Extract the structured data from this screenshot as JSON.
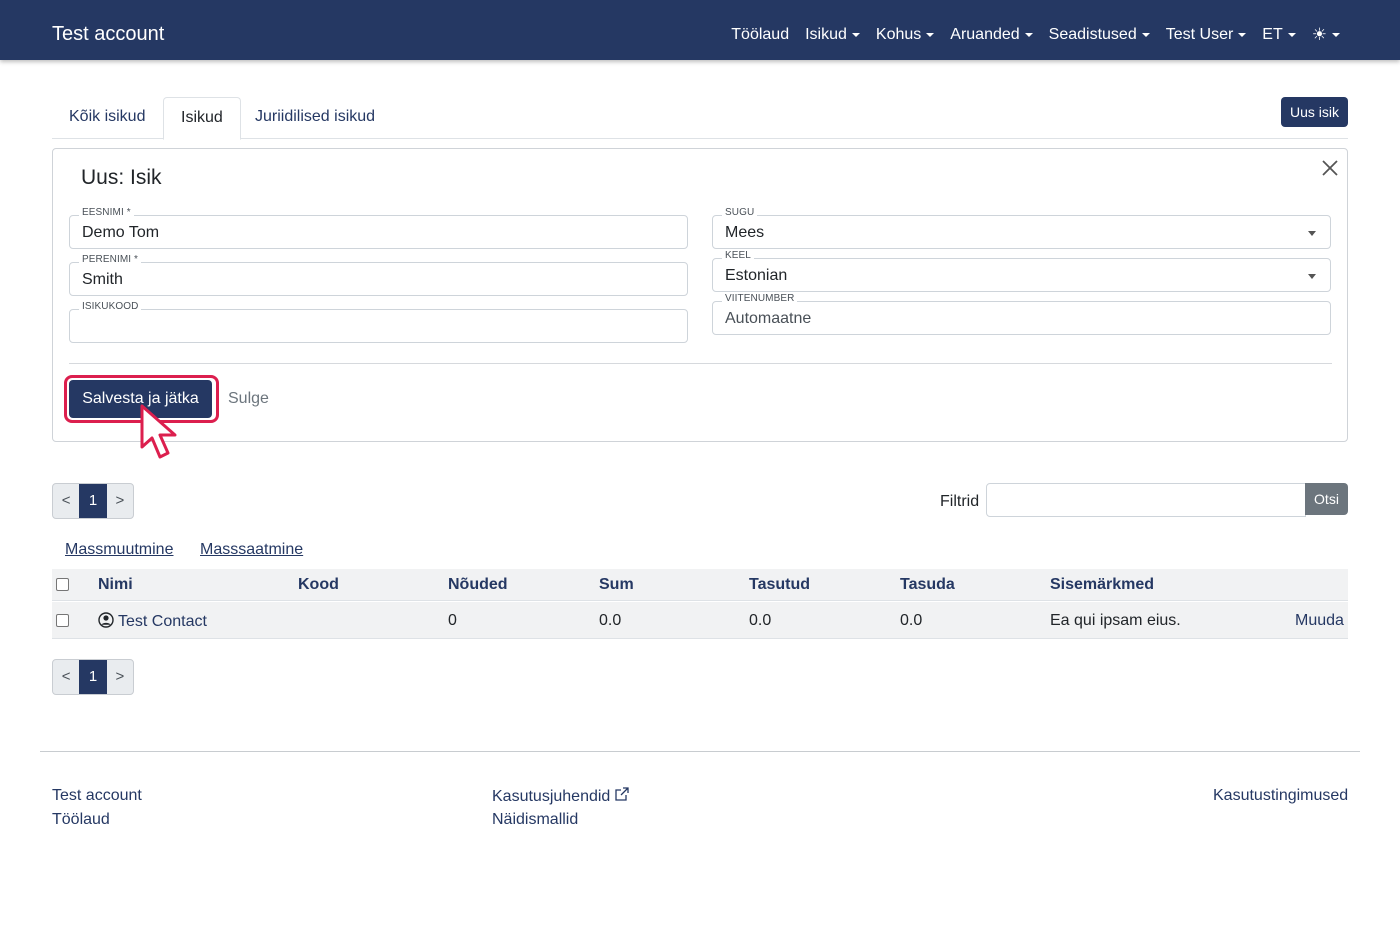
{
  "navbar": {
    "brand": "Test account",
    "items": [
      {
        "label": "Töölaud",
        "dropdown": false
      },
      {
        "label": "Isikud",
        "dropdown": true
      },
      {
        "label": "Kohus",
        "dropdown": true
      },
      {
        "label": "Aruanded",
        "dropdown": true
      },
      {
        "label": "Seadistused",
        "dropdown": true
      },
      {
        "label": "Test User",
        "dropdown": true
      },
      {
        "label": "ET",
        "dropdown": true
      }
    ],
    "theme_icon": "sun-icon",
    "bg_color": "#253863"
  },
  "tabs": [
    {
      "label": "Kõik isikud",
      "active": false
    },
    {
      "label": "Isikud",
      "active": true
    },
    {
      "label": "Juriidilised isikud",
      "active": false
    }
  ],
  "new_button": "Uus isik",
  "form": {
    "title": "Uus: Isik",
    "fields": {
      "first_name": {
        "label": "EESNIMI *",
        "value": "Demo Tom"
      },
      "last_name": {
        "label": "PERENIMI *",
        "value": "Smith"
      },
      "id_code": {
        "label": "ISIKUKOOD",
        "value": ""
      },
      "gender": {
        "label": "SUGU",
        "value": "Mees"
      },
      "language": {
        "label": "KEEL",
        "value": "Estonian"
      },
      "reference": {
        "label": "VIITENUMBER",
        "placeholder": "Automaatne"
      }
    },
    "save_button": "Salvesta ja jätka",
    "close_button": "Sulge"
  },
  "pagination": {
    "prev": "<",
    "current": "1",
    "next": ">"
  },
  "filter": {
    "label": "Filtrid",
    "value": "",
    "search_button": "Otsi"
  },
  "mass_actions": {
    "mass_edit": "Massmuutmine",
    "mass_send": "Masssaatmine"
  },
  "table": {
    "headers": [
      "Nimi",
      "Kood",
      "Nõuded",
      "Sum",
      "Tasutud",
      "Tasuda",
      "Sisemärkmed"
    ],
    "rows": [
      {
        "name": "Test Contact",
        "code": "",
        "claims": "0",
        "sum": "0.0",
        "paid": "0.0",
        "due": "0.0",
        "notes": "Ea qui ipsam eius.",
        "action": "Muuda"
      }
    ]
  },
  "footer": {
    "col1": [
      "Test account",
      "Töölaud"
    ],
    "col2": [
      "Kasutusjuhendid",
      "Näidismallid"
    ],
    "col3": [
      "Kasutustingimused"
    ]
  },
  "colors": {
    "primary": "#253863",
    "highlight": "#dc1f4e",
    "secondary": "#6c757d"
  }
}
